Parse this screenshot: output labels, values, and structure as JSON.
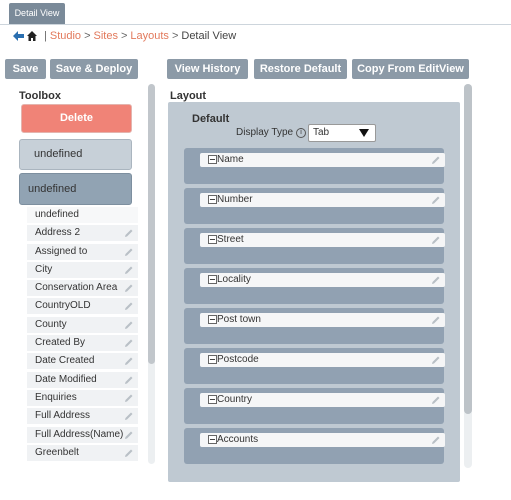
{
  "tabbar": {
    "tab_label": "Detail View"
  },
  "breadcrumb": {
    "sep": "|",
    "items": [
      "Studio",
      "Sites",
      "Layouts"
    ],
    "gt": ">",
    "current": "Detail View"
  },
  "toolbar": {
    "save": "Save",
    "save_deploy": "Save & Deploy",
    "view_history": "View History",
    "restore_default": "Restore Default",
    "copy_from_editview": "Copy From EditView"
  },
  "toolbox": {
    "title": "Toolbox",
    "delete_label": "Delete",
    "undefined_1": "undefined",
    "undefined_2": "undefined",
    "fields": [
      "undefined",
      "Address 2",
      "Assigned to",
      "City",
      "Conservation Area",
      "CountryOLD",
      "County",
      "Created By",
      "Date Created",
      "Date Modified",
      "Enquiries",
      "Full Address",
      "Full Address(Name)",
      "Greenbelt"
    ]
  },
  "layout": {
    "title": "Layout",
    "panel_label": "Default",
    "display_type_label": "Display Type",
    "display_type_suffix": ":",
    "info_glyph": "i",
    "display_type_value": "Tab",
    "fields": [
      "Name",
      "Number",
      "Street",
      "Locality",
      "Post town",
      "Postcode",
      "Country",
      "Accounts"
    ]
  },
  "icons": {
    "back": "back-arrow-icon",
    "home": "home-icon",
    "edit": "pencil-icon",
    "collapse": "minus-box-icon",
    "dropdown": "caret-down-icon"
  },
  "colors": {
    "accent": "#e2795c",
    "button": "#8c9aa7",
    "delete": "#f08377",
    "panel": "#bfc9d2",
    "row": "#91a1b2"
  }
}
